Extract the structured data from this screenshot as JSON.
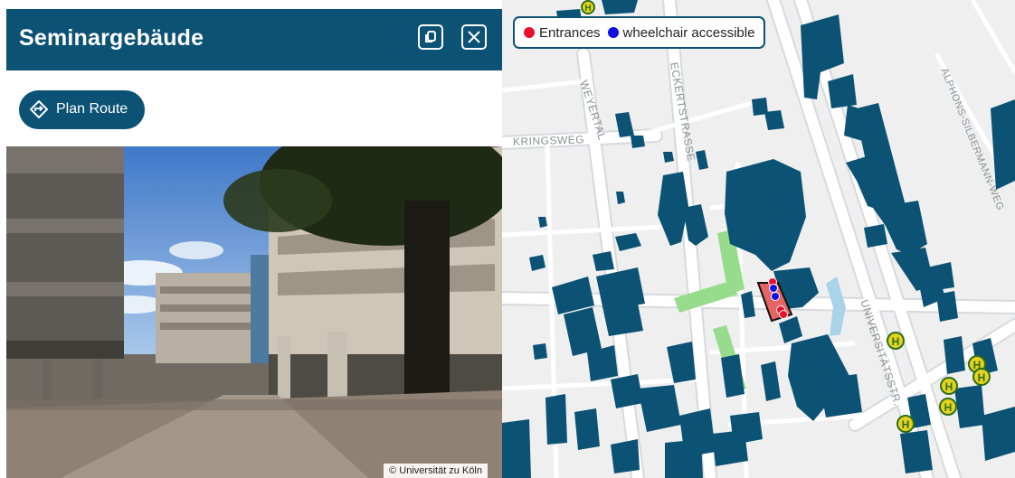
{
  "panel": {
    "title": "Seminargebäude",
    "route_label": "Plan Route",
    "photo_credit": "© Universität zu Köln"
  },
  "icons": {
    "copy": "copy-icon",
    "close": "close-icon",
    "route": "route-diamond-icon",
    "bus": "bus-stop-icon"
  },
  "map": {
    "legend": {
      "entrances": "Entrances",
      "accessible": "wheelchair accessible"
    },
    "streets": {
      "weyertal": "WEYERTAL",
      "eckertstrasse": "ECKERTSTRASSE",
      "kringsweg": "KRINGSWEG",
      "alphons": "ALPHONS-SILBERMANN-WEG",
      "universitaetsstr": "UNIVERSITÄTSSTR."
    },
    "bus_stop_letter": "H"
  },
  "colors": {
    "header": "#0b5274",
    "building": "#0b5274",
    "green": "#96dc8c",
    "water": "#a9d3e8",
    "entrance": "#e8102c",
    "accessible": "#1010e0",
    "highlight": "#e56565",
    "bus_stop": "#e7d21e"
  }
}
